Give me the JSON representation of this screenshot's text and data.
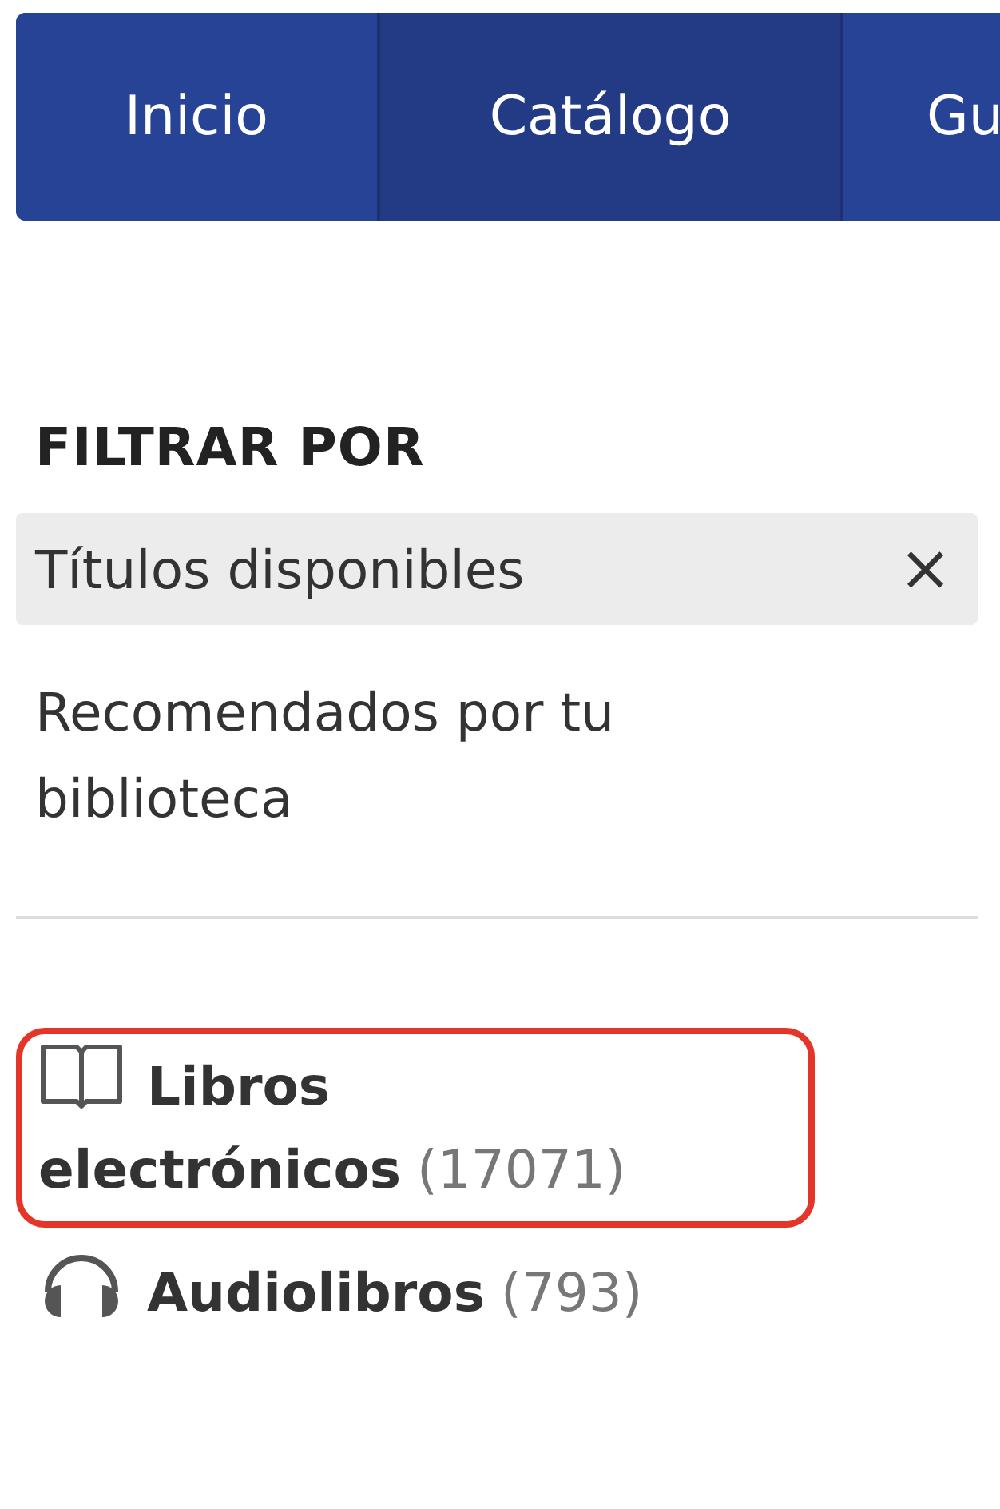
{
  "nav": [
    {
      "label": "Inicio",
      "selected": false
    },
    {
      "label": "Catálogo",
      "selected": true
    },
    {
      "label": "Gu",
      "selected": false
    }
  ],
  "filter": {
    "heading": "FILTRAR POR",
    "options": [
      {
        "label": "Títulos disponibles",
        "active": true,
        "remove": "×"
      },
      {
        "label": "Recomendados por tu biblioteca",
        "active": false
      }
    ]
  },
  "formats": [
    {
      "kind": "book",
      "label": "Libros electrónicos",
      "count": "(17071)",
      "highlighted": true
    },
    {
      "kind": "headphones",
      "label": "Audiolibros",
      "count": "(793)",
      "highlighted": false
    }
  ]
}
